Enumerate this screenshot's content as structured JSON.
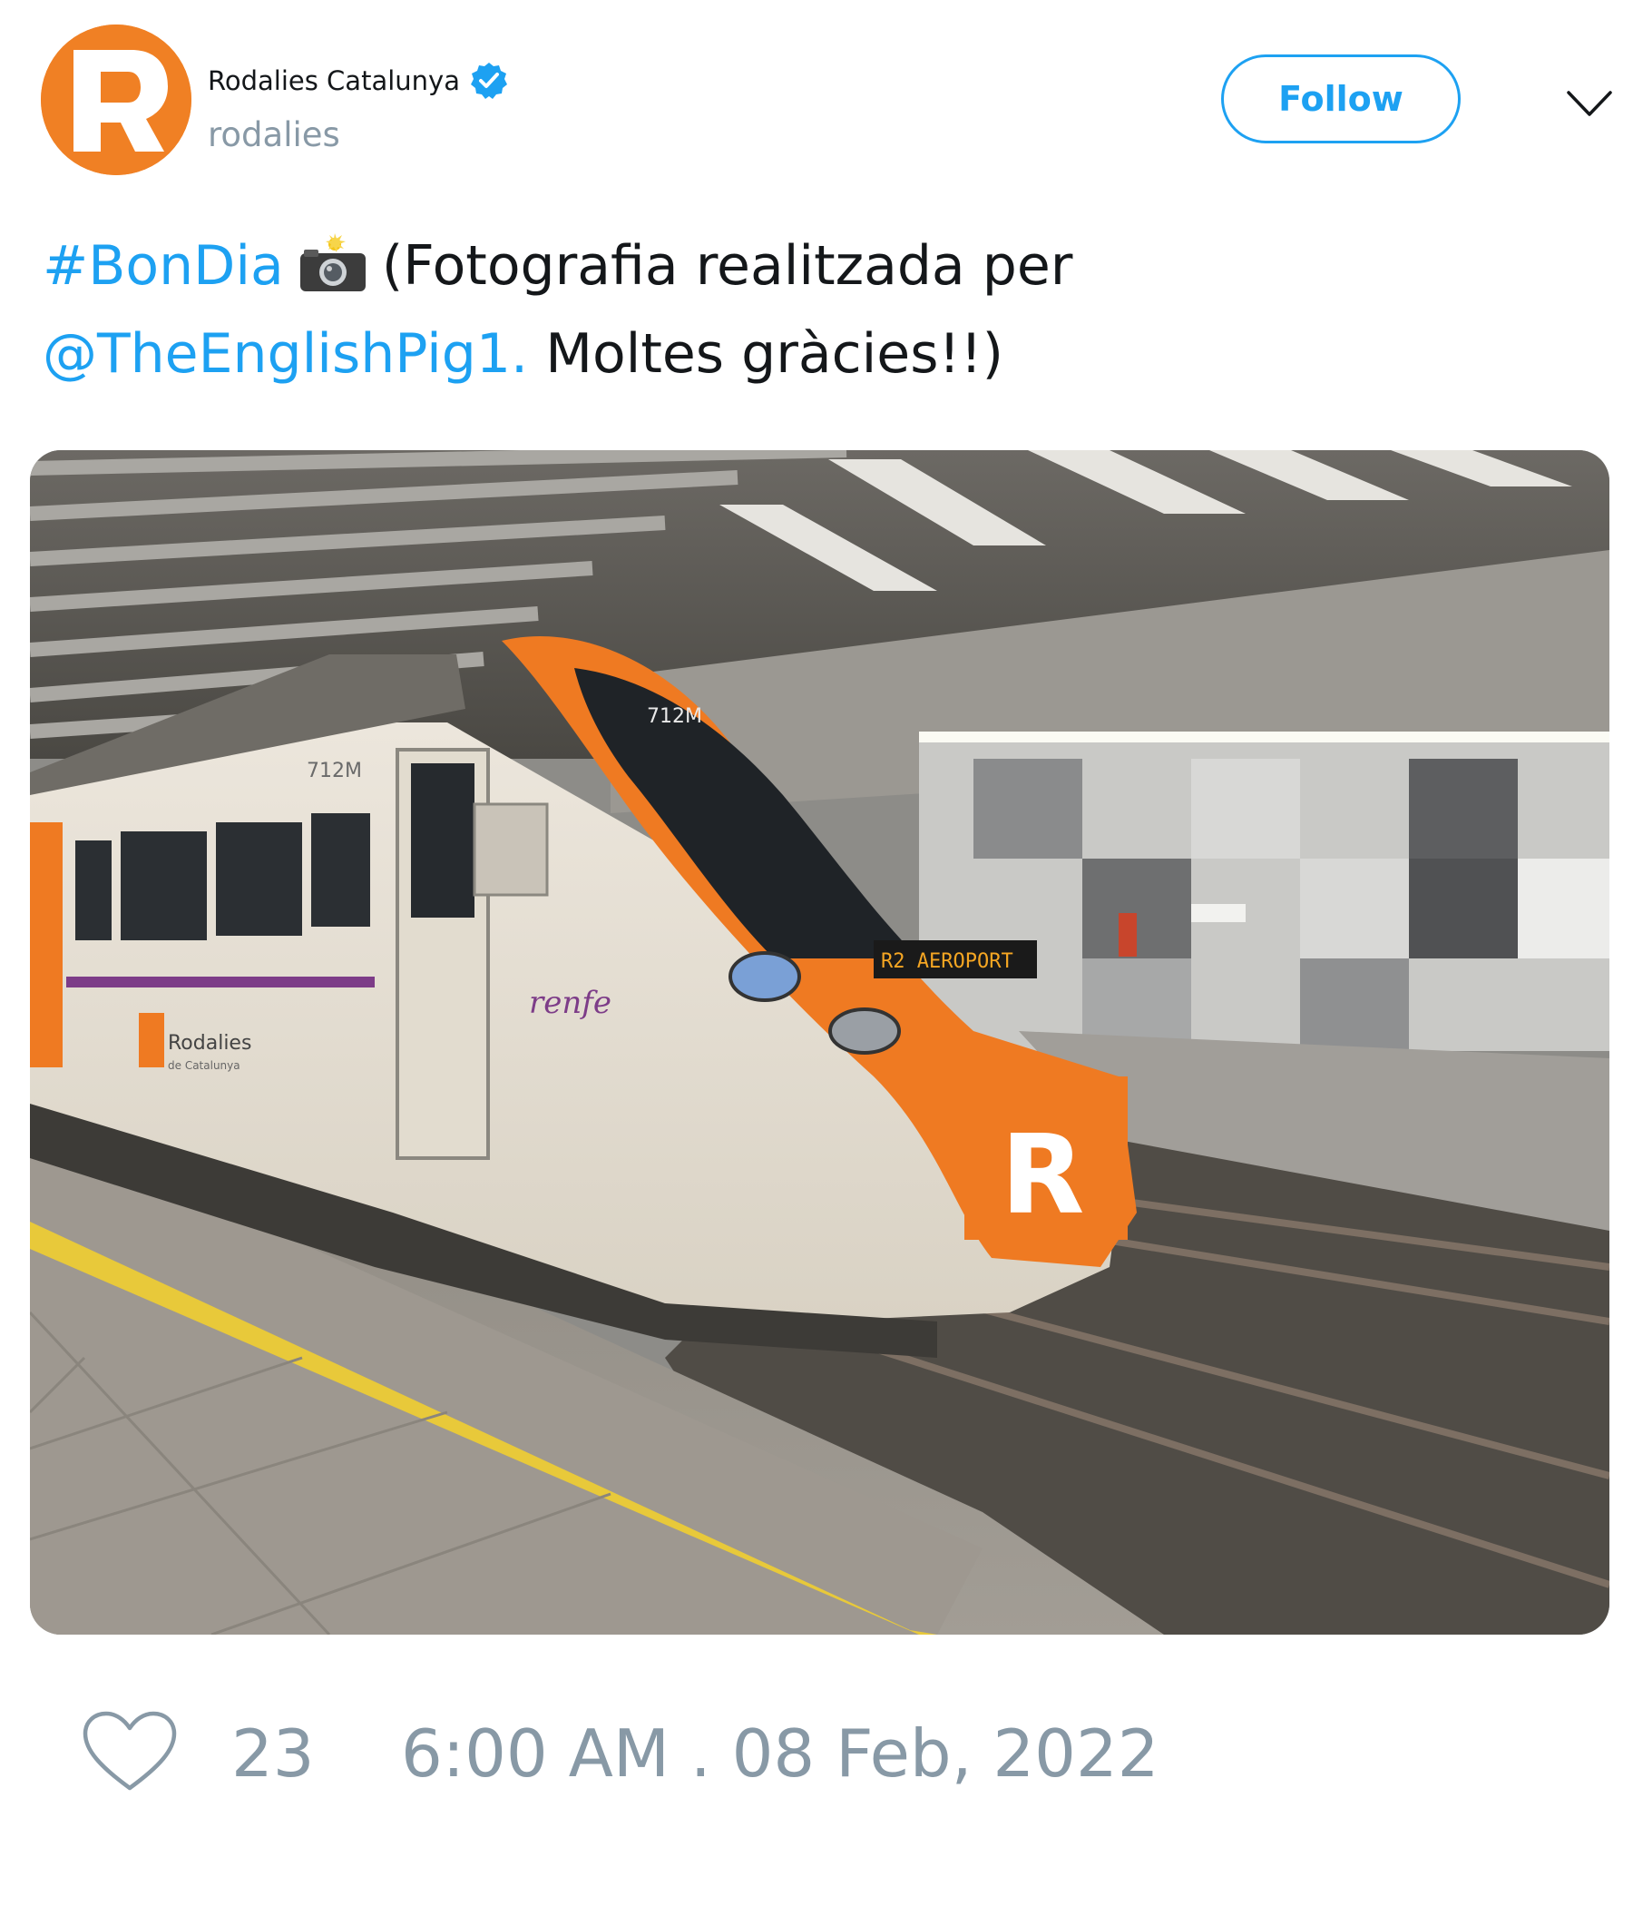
{
  "author": {
    "display_name": "Rodalies Catalunya",
    "handle": "rodalies",
    "verified": true,
    "avatar_icon": "rodalies-r-logo",
    "avatar_letter": "R",
    "brand_color": "#f08024"
  },
  "actions": {
    "follow_label": "Follow",
    "menu_icon": "chevron-down-icon"
  },
  "tweet": {
    "hashtag": "#BonDia",
    "emoji_icon": "camera-with-flash-icon",
    "text_part1": "(Fotografia realitzada per",
    "mention": "@TheEnglishPig1.",
    "text_part2": "Moltes gràcies!!)",
    "link_color": "#1da1f2"
  },
  "media": {
    "train_number": "712M",
    "destination_display": "R2 AEROPORT",
    "operator_label": "renfe",
    "brand_label": "Rodalies",
    "brand_sublabel": "de Catalunya",
    "logo_letter": "R"
  },
  "footer": {
    "heart_icon": "heart-outline-icon",
    "like_count": "23",
    "timestamp": "6:00 AM . 08 Feb, 2022"
  }
}
